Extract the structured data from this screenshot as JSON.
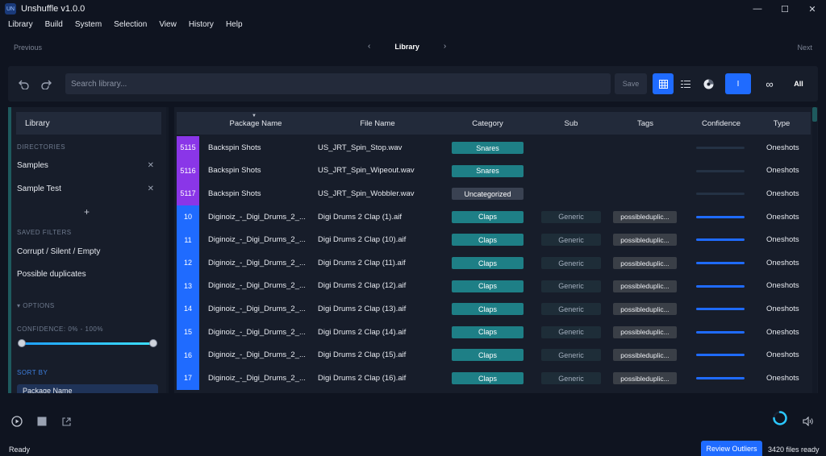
{
  "app": {
    "title": "Unshuffle v1.0.0",
    "logo": "UN"
  },
  "window_controls": [
    "—",
    "☐",
    "✕"
  ],
  "menu": [
    "Library",
    "Build",
    "System",
    "Selection",
    "View",
    "History",
    "Help"
  ],
  "nav": {
    "previous": "Previous",
    "title": "Library",
    "next": "Next"
  },
  "toolbar": {
    "search_placeholder": "Search library...",
    "save_label": "Save",
    "mode_i": "I",
    "mode_infinite": "∞",
    "mode_all": "All"
  },
  "sidebar": {
    "header": "Library",
    "directories_title": "DIRECTORIES",
    "directories": [
      "Samples",
      "Sample Test"
    ],
    "remove_glyph": "✕",
    "add_glyph": "+",
    "saved_filters_title": "SAVED FILTERS",
    "saved_filters": [
      "Corrupt / Silent / Empty",
      "Possible duplicates"
    ],
    "options_title": "▾  OPTIONS",
    "confidence_label": "CONFIDENCE: 0% - 100%",
    "confidence_range": [
      0,
      100
    ],
    "sort_by_title": "SORT BY",
    "sort_value": "Package Name"
  },
  "table": {
    "columns": [
      "Package Name",
      "File Name",
      "Category",
      "Sub",
      "Tags",
      "Confidence",
      "Type"
    ],
    "rows": [
      {
        "index": "5115",
        "package": "Backspin Shots",
        "file": "US_JRT_Spin_Stop.wav",
        "category": "Snares",
        "sub": "",
        "tags": "",
        "type": "Oneshots",
        "idx_color": "#8a36e8",
        "cat_color": "#1e7f86",
        "conf_color": "#243244"
      },
      {
        "index": "5116",
        "package": "Backspin Shots",
        "file": "US_JRT_Spin_Wipeout.wav",
        "category": "Snares",
        "sub": "",
        "tags": "",
        "type": "Oneshots",
        "idx_color": "#8a36e8",
        "cat_color": "#1e7f86",
        "conf_color": "#243244"
      },
      {
        "index": "5117",
        "package": "Backspin Shots",
        "file": "US_JRT_Spin_Wobbler.wav",
        "category": "Uncategorized",
        "sub": "",
        "tags": "",
        "type": "Oneshots",
        "idx_color": "#8a36e8",
        "cat_color": "#3a4252",
        "conf_color": "#243244"
      },
      {
        "index": "10",
        "package": "Diginoiz_-_Digi_Drums_2_...",
        "file": "Digi Drums 2 Clap (1).aif",
        "category": "Claps",
        "sub": "Generic",
        "tags": "possibleduplic...",
        "type": "Oneshots",
        "idx_color": "#1f6bff",
        "cat_color": "#1e7f86",
        "conf_color": "#1f6bff"
      },
      {
        "index": "11",
        "package": "Diginoiz_-_Digi_Drums_2_...",
        "file": "Digi Drums 2 Clap (10).aif",
        "category": "Claps",
        "sub": "Generic",
        "tags": "possibleduplic...",
        "type": "Oneshots",
        "idx_color": "#1f6bff",
        "cat_color": "#1e7f86",
        "conf_color": "#1f6bff"
      },
      {
        "index": "12",
        "package": "Diginoiz_-_Digi_Drums_2_...",
        "file": "Digi Drums 2 Clap (11).aif",
        "category": "Claps",
        "sub": "Generic",
        "tags": "possibleduplic...",
        "type": "Oneshots",
        "idx_color": "#1f6bff",
        "cat_color": "#1e7f86",
        "conf_color": "#1f6bff"
      },
      {
        "index": "13",
        "package": "Diginoiz_-_Digi_Drums_2_...",
        "file": "Digi Drums 2 Clap (12).aif",
        "category": "Claps",
        "sub": "Generic",
        "tags": "possibleduplic...",
        "type": "Oneshots",
        "idx_color": "#1f6bff",
        "cat_color": "#1e7f86",
        "conf_color": "#1f6bff"
      },
      {
        "index": "14",
        "package": "Diginoiz_-_Digi_Drums_2_...",
        "file": "Digi Drums 2 Clap (13).aif",
        "category": "Claps",
        "sub": "Generic",
        "tags": "possibleduplic...",
        "type": "Oneshots",
        "idx_color": "#1f6bff",
        "cat_color": "#1e7f86",
        "conf_color": "#1f6bff"
      },
      {
        "index": "15",
        "package": "Diginoiz_-_Digi_Drums_2_...",
        "file": "Digi Drums 2 Clap (14).aif",
        "category": "Claps",
        "sub": "Generic",
        "tags": "possibleduplic...",
        "type": "Oneshots",
        "idx_color": "#1f6bff",
        "cat_color": "#1e7f86",
        "conf_color": "#1f6bff"
      },
      {
        "index": "16",
        "package": "Diginoiz_-_Digi_Drums_2_...",
        "file": "Digi Drums 2 Clap (15).aif",
        "category": "Claps",
        "sub": "Generic",
        "tags": "possibleduplic...",
        "type": "Oneshots",
        "idx_color": "#1f6bff",
        "cat_color": "#1e7f86",
        "conf_color": "#1f6bff"
      },
      {
        "index": "17",
        "package": "Diginoiz_-_Digi_Drums_2_...",
        "file": "Digi Drums 2 Clap (16).aif",
        "category": "Claps",
        "sub": "Generic",
        "tags": "possibleduplic...",
        "type": "Oneshots",
        "idx_color": "#1f6bff",
        "cat_color": "#1e7f86",
        "conf_color": "#1f6bff"
      }
    ]
  },
  "status": {
    "left": "Ready",
    "review_button": "Review Outliers",
    "files_ready": "3420 files ready"
  },
  "colors": {
    "accent": "#1f6bff",
    "teal": "#1e7f86",
    "purple": "#8a36e8",
    "background": "#0f1420",
    "panel": "#171d2a"
  },
  "icons": [
    "undo-icon",
    "redo-icon",
    "grid-view-icon",
    "list-view-icon",
    "disc-icon",
    "play-icon",
    "stop-icon",
    "open-external-icon",
    "volume-icon"
  ]
}
